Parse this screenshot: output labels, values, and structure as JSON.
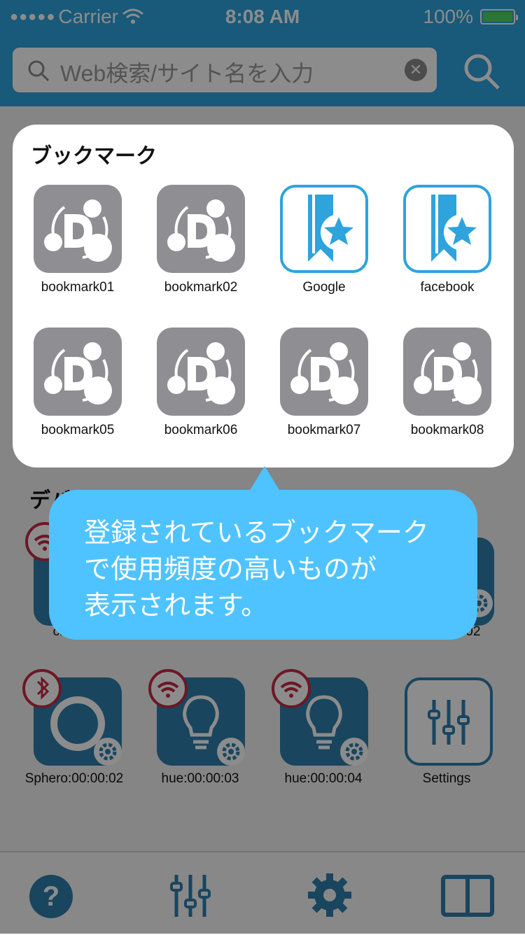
{
  "status_bar": {
    "carrier": "Carrier",
    "time": "8:08 AM",
    "battery": "100%"
  },
  "search": {
    "placeholder": "Web検索/サイト名を入力"
  },
  "bookmarks": {
    "title": "ブックマーク",
    "items": [
      {
        "label": "bookmark01",
        "icon": "device-connect-icon"
      },
      {
        "label": "bookmark02",
        "icon": "device-connect-icon"
      },
      {
        "label": "Google",
        "icon": "bookmark-star-icon"
      },
      {
        "label": "facebook",
        "icon": "bookmark-star-icon"
      },
      {
        "label": "bookmark05",
        "icon": "device-connect-icon"
      },
      {
        "label": "bookmark06",
        "icon": "device-connect-icon"
      },
      {
        "label": "bookmark07",
        "icon": "device-connect-icon"
      },
      {
        "label": "bookmark08",
        "icon": "device-connect-icon"
      }
    ]
  },
  "devices": {
    "title": "デバイス",
    "row1": [
      {
        "label": "chr",
        "badge": "wifi-icon"
      },
      {
        "label": ":02",
        "badge": ""
      }
    ],
    "row2": [
      {
        "label": "Sphero:00:00:02",
        "badge": "bluetooth-icon"
      },
      {
        "label": "hue:00:00:03",
        "badge": "wifi-icon"
      },
      {
        "label": "hue:00:00:04",
        "badge": "wifi-icon"
      },
      {
        "label": "Settings",
        "badge": ""
      }
    ]
  },
  "tooltip": {
    "text": "登録されているブックマーク\nで使用頻度の高いものが\n表示されます。"
  },
  "tabbar": {
    "items": [
      "help-icon",
      "sliders-icon",
      "gear-icon",
      "book-icon"
    ]
  },
  "colors": {
    "brand": "#2fa3dc",
    "tooltip": "#4fc3ff",
    "device_tile": "#2f7fae",
    "badge_ring": "#c62a44"
  }
}
